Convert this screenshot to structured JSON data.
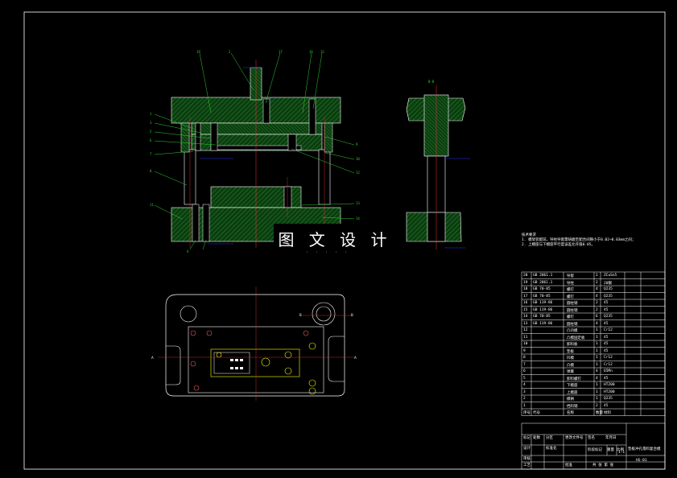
{
  "watermark": {
    "text": "图 文 设 计",
    "sub": "· · · · ·"
  },
  "section_label": "B-B",
  "notes": {
    "title": "技术要求",
    "lines": [
      "1. 模架装配前，导柱导套需研磨至配合间隙小于0.02~0.03mm之间；",
      "2. 上模座与下模座平行度误差允许值0.05。"
    ]
  },
  "bom_rows": [
    [
      "20",
      "GB 2861.1",
      "导套",
      "2",
      "ZCuSn5"
    ],
    [
      "19",
      "GB 2861.1",
      "导柱",
      "2",
      "20钢"
    ],
    [
      "18",
      "GB 70-85",
      "螺钉",
      "4",
      "Q235"
    ],
    [
      "17",
      "GB 70-85",
      "螺钉",
      "4",
      "Q235"
    ],
    [
      "16",
      "GB 119-86",
      "圆柱销",
      "2",
      "45"
    ],
    [
      "15",
      "GB 119-86",
      "圆柱销",
      "2",
      "45"
    ],
    [
      "14",
      "GB 70-85",
      "螺钉",
      "6",
      "Q235"
    ],
    [
      "13",
      "GB 119-86",
      "圆柱销",
      "4",
      "45"
    ],
    [
      "12",
      "",
      "凸凹模",
      "1",
      "Cr12"
    ],
    [
      "11",
      "",
      "凸模固定板",
      "1",
      "45"
    ],
    [
      "10",
      "",
      "卸料板",
      "1",
      "45"
    ],
    [
      "9",
      "",
      "垫板",
      "1",
      "45"
    ],
    [
      "8",
      "",
      "凹模",
      "1",
      "Cr12"
    ],
    [
      "7",
      "",
      "凸模",
      "1",
      "Cr12"
    ],
    [
      "6",
      "",
      "弹簧",
      "4",
      "65Mn"
    ],
    [
      "5",
      "",
      "卸料螺钉",
      "4",
      "45"
    ],
    [
      "4",
      "",
      "下模座",
      "1",
      "HT200"
    ],
    [
      "3",
      "",
      "上模座",
      "1",
      "HT200"
    ],
    [
      "2",
      "",
      "模柄",
      "1",
      "Q235"
    ],
    [
      "1",
      "",
      "挡料销",
      "2",
      "45"
    ]
  ],
  "bom_header": [
    "序号",
    "代号",
    "名称",
    "数量",
    "材料"
  ],
  "title_block": {
    "drawing_title": "垫板冲孔落料复合模",
    "drawing_no": "HS-01",
    "labels": [
      "标记",
      "处数",
      "分区",
      "更改文件号",
      "签名",
      "年月日",
      "设计",
      "标准化",
      "审核",
      "工艺",
      "批准",
      "阶段标记",
      "重量",
      "比例",
      "共 张 第 张"
    ],
    "scale": "1:1"
  },
  "balloons_top": [
    "19",
    "2",
    "17",
    "16",
    "15"
  ],
  "balloons_left": [
    "1",
    "3",
    "5",
    "6",
    "7",
    "8",
    "11",
    "4"
  ],
  "balloons_right": [
    "9",
    "10",
    "12",
    "13",
    "14"
  ],
  "bottom_labels": {
    "left": "A",
    "right": "A",
    "b_top": "B",
    "b_bottom": "B"
  }
}
